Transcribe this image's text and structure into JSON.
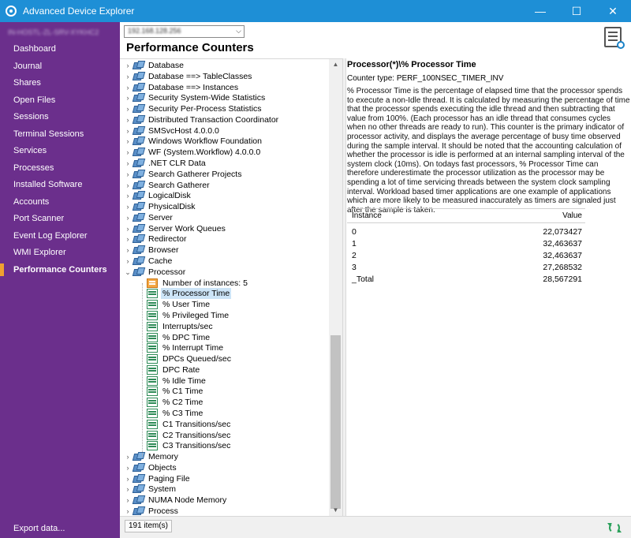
{
  "window": {
    "title": "Advanced Device Explorer"
  },
  "sidebar": {
    "host": "IN-HOSTL-ZL-SRV-XYKHC2",
    "items": [
      {
        "label": "Dashboard"
      },
      {
        "label": "Journal"
      },
      {
        "label": "Shares"
      },
      {
        "label": "Open Files"
      },
      {
        "label": "Sessions"
      },
      {
        "label": "Terminal Sessions"
      },
      {
        "label": "Services"
      },
      {
        "label": "Processes"
      },
      {
        "label": "Installed Software"
      },
      {
        "label": "Accounts"
      },
      {
        "label": "Port Scanner"
      },
      {
        "label": "Event Log Explorer"
      },
      {
        "label": "WMI Explorer"
      },
      {
        "label": "Performance Counters",
        "active": true
      }
    ],
    "export_label": "Export data..."
  },
  "header": {
    "ip_value": "192.168.128.256",
    "page_title": "Performance Counters"
  },
  "tree": {
    "categories_top": [
      "Database",
      "Database ==> TableClasses",
      "Database ==> Instances",
      "Security System-Wide Statistics",
      "Security Per-Process Statistics",
      "Distributed Transaction Coordinator",
      "SMSvcHost 4.0.0.0",
      "Windows Workflow Foundation",
      "WF (System.Workflow) 4.0.0.0",
      ".NET CLR Data",
      "Search Gatherer Projects",
      "Search Gatherer",
      "LogicalDisk",
      "PhysicalDisk",
      "Server",
      "Server Work Queues",
      "Redirector",
      "Browser",
      "Cache"
    ],
    "expanded_category": "Processor",
    "instances_label": "Number of instances: 5",
    "counters": [
      "% Processor Time",
      "% User Time",
      "% Privileged Time",
      "Interrupts/sec",
      "% DPC Time",
      "% Interrupt Time",
      "DPCs Queued/sec",
      "DPC Rate",
      "% Idle Time",
      "% C1 Time",
      "% C2 Time",
      "% C3 Time",
      "C1 Transitions/sec",
      "C2 Transitions/sec",
      "C3 Transitions/sec"
    ],
    "selected_counter": "% Processor Time",
    "categories_bottom": [
      "Memory",
      "Objects",
      "Paging File",
      "System",
      "NUMA Node Memory",
      "Process"
    ]
  },
  "detail": {
    "title": "Processor(*)\\% Processor Time",
    "counter_type": "Counter type: PERF_100NSEC_TIMER_INV",
    "description": "% Processor Time is the percentage of elapsed time that the processor spends to execute a non-Idle thread. It is calculated by measuring the percentage of time that the processor spends executing the idle thread and then subtracting that value from 100%. (Each processor has an idle thread that consumes cycles when no other threads are ready to run). This counter is the primary indicator of processor activity, and displays the average percentage of busy time observed during the sample interval. It should be noted that the accounting calculation of whether the processor is idle is performed at an internal sampling interval of the system clock (10ms). On todays fast processors, % Processor Time can therefore underestimate the processor utilization as the processor may be spending a lot of time servicing threads between the system clock sampling interval. Workload based timer applications are one example  of applications  which are more likely to be measured inaccurately as timers are signaled just after the sample is taken.",
    "table": {
      "col_instance": "Instance",
      "col_value": "Value",
      "rows": [
        {
          "instance": "0",
          "value": "22,073427"
        },
        {
          "instance": "1",
          "value": "32,463637"
        },
        {
          "instance": "2",
          "value": "32,463637"
        },
        {
          "instance": "3",
          "value": "27,268532"
        },
        {
          "instance": "_Total",
          "value": "28,567291"
        }
      ]
    }
  },
  "status": {
    "item_count": "191 item(s)"
  },
  "colors": {
    "titlebar": "#1e8fd6",
    "sidebar": "#6b2f8c",
    "active_marker": "#f0a030",
    "selection": "#cce4f7"
  },
  "icons": {
    "category": "counter-category-icon",
    "counter": "counter-icon",
    "instances": "instances-icon",
    "refresh": "refresh-icon",
    "report": "report-search-icon"
  }
}
